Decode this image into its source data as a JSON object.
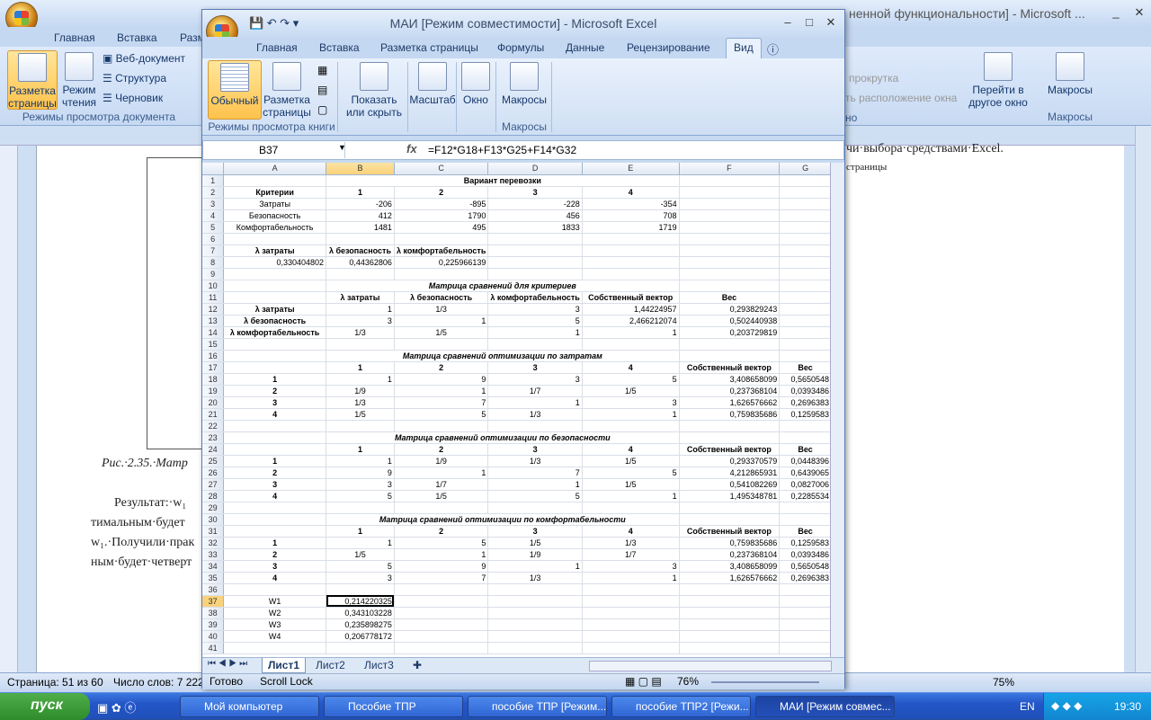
{
  "word": {
    "title_fragment": "ненной функциональности] - Microsoft ...",
    "tabs": [
      "Главная",
      "Вставка",
      "Разм"
    ],
    "ribbon": {
      "page_layout": "Разметка страницы",
      "reading": "Режим чтения",
      "web_doc": "Веб-документ",
      "structure": "Структура",
      "draft": "Черновик",
      "group_label": "Режимы просмотра документа",
      "right_fragment1": "прокрутка",
      "right_fragment2": "ть расположение окна",
      "right_fragment3": "но",
      "goto_other": "Перейти в другое окно",
      "macros": "Макросы",
      "macros_group": "Макросы"
    },
    "doc_text": {
      "caption": "Рис.·2.35.·Матр",
      "res1": "Результат:·w₁",
      "res2": "тимальным·будет",
      "res3": "w₁.·Получили·прак",
      "res4": "ным·будет·четверт",
      "right1": "чи·выбора·средствами·Excel.",
      "right2": "страницы"
    },
    "status": {
      "page": "Страница: 51 из 60",
      "words": "Число слов: 7 222",
      "zoom": "75%"
    }
  },
  "excel": {
    "title": "МАИ  [Режим совместимости] - Microsoft Excel",
    "tabs": [
      "Главная",
      "Вставка",
      "Разметка страницы",
      "Формулы",
      "Данные",
      "Рецензирование",
      "Вид"
    ],
    "ribbon": {
      "normal": "Обычный",
      "page_layout": "Разметка страницы",
      "show_hide": "Показать или скрыть",
      "zoom": "Масштаб",
      "window": "Окно",
      "macros": "Макросы",
      "group_views": "Режимы просмотра книги",
      "group_macros": "Макросы"
    },
    "namebox": "B37",
    "fx": "fx",
    "formula": "=F12*G18+F13*G25+F14*G32",
    "columns": [
      "A",
      "B",
      "C",
      "D",
      "E",
      "F",
      "G"
    ],
    "rows": [
      [
        "1",
        "",
        "Вариант перевозки",
        "",
        "",
        "",
        "",
        ""
      ],
      [
        "2",
        "Критерии",
        "1",
        "2",
        "3",
        "4",
        "",
        ""
      ],
      [
        "3",
        "Затраты",
        "-206",
        "-895",
        "-228",
        "-354",
        "",
        ""
      ],
      [
        "4",
        "Безопасность",
        "412",
        "1790",
        "456",
        "708",
        "",
        ""
      ],
      [
        "5",
        "Комфортабельность",
        "1481",
        "495",
        "1833",
        "1719",
        "",
        ""
      ],
      [
        "6",
        "",
        "",
        "",
        "",
        "",
        "",
        ""
      ],
      [
        "7",
        "λ затраты",
        "λ безопасность",
        "λ комфортабельность",
        "",
        "",
        "",
        ""
      ],
      [
        "8",
        "0,330404802",
        "0,44362806",
        "0,225966139",
        "",
        "",
        "",
        ""
      ],
      [
        "9",
        "",
        "",
        "",
        "",
        "",
        "",
        ""
      ],
      [
        "10",
        "",
        "Матрица сравнений для критериев",
        "",
        "",
        "",
        "",
        ""
      ],
      [
        "11",
        "",
        "λ затраты",
        "λ безопасность",
        "λ комфортабельность",
        "Собственный вектор",
        "Вес",
        ""
      ],
      [
        "12",
        "λ затраты",
        "1",
        "1/3",
        "3",
        "1,44224957",
        "0,293829243",
        ""
      ],
      [
        "13",
        "λ безопасность",
        "3",
        "1",
        "5",
        "2,466212074",
        "0,502440938",
        ""
      ],
      [
        "14",
        "λ комфортабельность",
        "1/3",
        "1/5",
        "1",
        "1",
        "0,203729819",
        ""
      ],
      [
        "15",
        "",
        "",
        "",
        "",
        "",
        "",
        ""
      ],
      [
        "16",
        "",
        "Матрица сравнений оптимизации по затратам",
        "",
        "",
        "",
        "",
        ""
      ],
      [
        "17",
        "",
        "1",
        "2",
        "3",
        "4",
        "Собственный вектор",
        "Вес"
      ],
      [
        "18",
        "1",
        "1",
        "9",
        "3",
        "5",
        "3,408658099",
        "0,5650548"
      ],
      [
        "19",
        "2",
        "1/9",
        "1",
        "1/7",
        "1/5",
        "0,237368104",
        "0,0393486"
      ],
      [
        "20",
        "3",
        "1/3",
        "7",
        "1",
        "3",
        "1,626576662",
        "0,2696383"
      ],
      [
        "21",
        "4",
        "1/5",
        "5",
        "1/3",
        "1",
        "0,759835686",
        "0,1259583"
      ],
      [
        "22",
        "",
        "",
        "",
        "",
        "",
        "",
        ""
      ],
      [
        "23",
        "",
        "Матрица сравнений оптимизации по безопасности",
        "",
        "",
        "",
        "",
        ""
      ],
      [
        "24",
        "",
        "1",
        "2",
        "3",
        "4",
        "Собственный вектор",
        "Вес"
      ],
      [
        "25",
        "1",
        "1",
        "1/9",
        "1/3",
        "1/5",
        "0,293370579",
        "0,0448396"
      ],
      [
        "26",
        "2",
        "9",
        "1",
        "7",
        "5",
        "4,212865931",
        "0,6439065"
      ],
      [
        "27",
        "3",
        "3",
        "1/7",
        "1",
        "1/5",
        "0,541082269",
        "0,0827006"
      ],
      [
        "28",
        "4",
        "5",
        "1/5",
        "5",
        "1",
        "1,495348781",
        "0,2285534"
      ],
      [
        "29",
        "",
        "",
        "",
        "",
        "",
        "",
        ""
      ],
      [
        "30",
        "",
        "Матрица сравнений оптимизации по комфортабельности",
        "",
        "",
        "",
        "",
        ""
      ],
      [
        "31",
        "",
        "1",
        "2",
        "3",
        "4",
        "Собственный вектор",
        "Вес"
      ],
      [
        "32",
        "1",
        "1",
        "5",
        "1/5",
        "1/3",
        "0,759835686",
        "0,1259583"
      ],
      [
        "33",
        "2",
        "1/5",
        "1",
        "1/9",
        "1/7",
        "0,237368104",
        "0,0393486"
      ],
      [
        "34",
        "3",
        "5",
        "9",
        "1",
        "3",
        "3,408658099",
        "0,5650548"
      ],
      [
        "35",
        "4",
        "3",
        "7",
        "1/3",
        "1",
        "1,626576662",
        "0,2696383"
      ],
      [
        "36",
        "",
        "",
        "",
        "",
        "",
        "",
        ""
      ],
      [
        "37",
        "W1",
        "0,214220325",
        "",
        "",
        "",
        "",
        ""
      ],
      [
        "38",
        "W2",
        "0,343103228",
        "",
        "",
        "",
        "",
        ""
      ],
      [
        "39",
        "W3",
        "0,235898275",
        "",
        "",
        "",
        "",
        ""
      ],
      [
        "40",
        "W4",
        "0,206778172",
        "",
        "",
        "",
        "",
        ""
      ],
      [
        "41",
        "",
        "",
        "",
        "",
        "",
        "",
        ""
      ]
    ],
    "sheets": [
      "Лист1",
      "Лист2",
      "Лист3"
    ],
    "status": {
      "ready": "Готово",
      "scroll_lock": "Scroll Lock",
      "zoom": "76%"
    }
  },
  "taskbar": {
    "start": "пуск",
    "tasks": [
      "Мой компьютер",
      "Пособие ТПР",
      "пособие ТПР [Режим...",
      "пособие ТПР2 [Режи...",
      "МАИ  [Режим совмес..."
    ],
    "lang": "EN",
    "time": "19:30"
  }
}
